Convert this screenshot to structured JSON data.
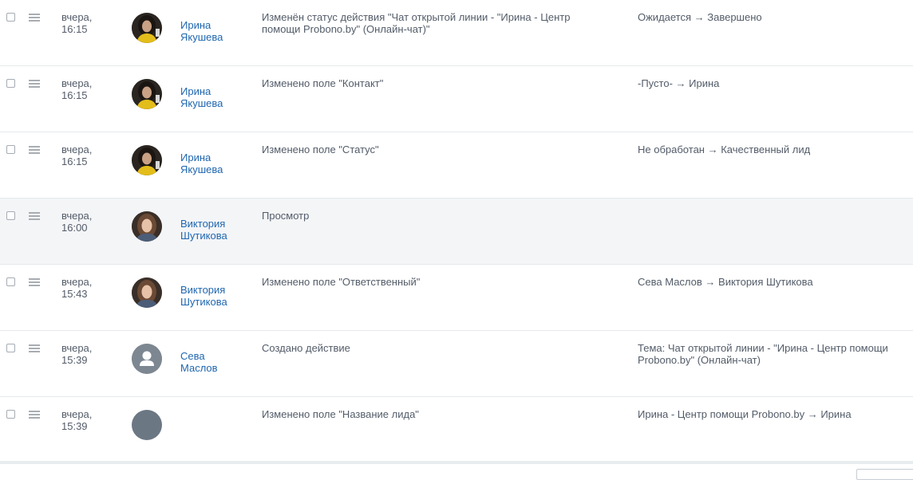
{
  "rows": [
    {
      "date_day": "вчера,",
      "date_time": "16:15",
      "user_first": "Ирина",
      "user_last": "Якушева",
      "avatar": "photo-irina",
      "action": "Изменён статус действия \"Чат открытой линии - \"Ирина - Центр помощи Probono.by\" (Онлайн-чат)\"",
      "change": "Ожидается → Завершено"
    },
    {
      "date_day": "вчера,",
      "date_time": "16:15",
      "user_first": "Ирина",
      "user_last": "Якушева",
      "avatar": "photo-irina",
      "action": "Изменено поле \"Контакт\"",
      "change": "-Пусто- → Ирина"
    },
    {
      "date_day": "вчера,",
      "date_time": "16:15",
      "user_first": "Ирина",
      "user_last": "Якушева",
      "avatar": "photo-irina",
      "action": "Изменено поле \"Статус\"",
      "change": "Не обработан → Качественный лид"
    },
    {
      "date_day": "вчера,",
      "date_time": "16:00",
      "user_first": "Виктория",
      "user_last": "Шутикова",
      "avatar": "photo-viktoria",
      "action": "Просмотр",
      "change": ""
    },
    {
      "date_day": "вчера,",
      "date_time": "15:43",
      "user_first": "Виктория",
      "user_last": "Шутикова",
      "avatar": "photo-viktoria",
      "action": "Изменено поле \"Ответственный\"",
      "change": "Сева Маслов → Виктория Шутикова"
    },
    {
      "date_day": "вчера,",
      "date_time": "15:39",
      "user_first": "Сева",
      "user_last": "Маслов",
      "avatar": "default-user",
      "action": "Создано действие",
      "change": "Тема: Чат открытой линии - \"Ирина - Центр помощи Probono.by\" (Онлайн-чат)"
    },
    {
      "date_day": "вчера,",
      "date_time": "15:39",
      "user_first": "",
      "user_last": "",
      "avatar": "blank",
      "action": "Изменено поле \"Название лида\"",
      "change": "Ирина - Центр помощи Probono.by → Ирина"
    }
  ],
  "colors": {
    "link": "#2067b0",
    "text": "#535c69",
    "row_highlight": "#f4f5f7",
    "divider": "#e6e9ec"
  }
}
